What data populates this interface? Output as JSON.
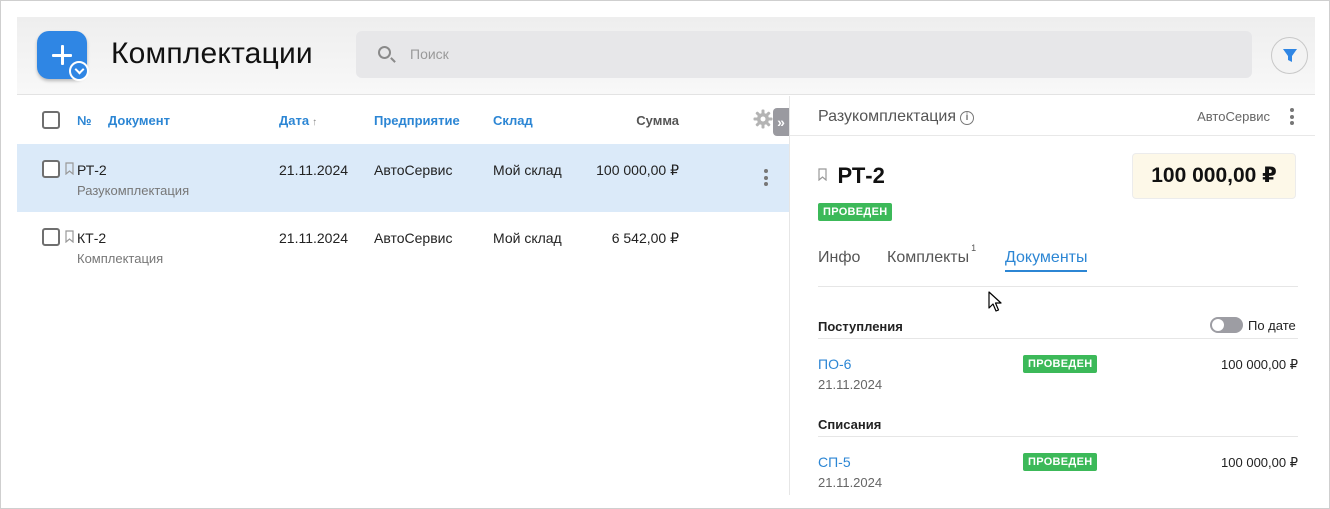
{
  "header": {
    "title": "Комплектации",
    "search_placeholder": "Поиск"
  },
  "table": {
    "columns": {
      "number": "№",
      "document": "Документ",
      "date": "Дата",
      "date_sort": "↑",
      "enterprise": "Предприятие",
      "warehouse": "Склад",
      "sum": "Сумма"
    },
    "collapse_label": "»",
    "rows": [
      {
        "number": "РТ-2",
        "type": "Разукомплектация",
        "date": "21.11.2024",
        "enterprise": "АвтоСервис",
        "warehouse": "Мой склад",
        "sum": "100 000,00 ₽",
        "selected": true
      },
      {
        "number": "КТ-2",
        "type": "Комплектация",
        "date": "21.11.2024",
        "enterprise": "АвтоСервис",
        "warehouse": "Мой склад",
        "sum": "6 542,00 ₽",
        "selected": false
      }
    ]
  },
  "detail": {
    "type": "Разукомплектация",
    "info_glyph": "i",
    "company": "АвтоСервис",
    "number": "РТ-2",
    "amount": "100 000,00 ₽",
    "status": "ПРОВЕДЕН",
    "tabs": {
      "info": "Инфо",
      "kits": "Комплекты",
      "kits_count": "1",
      "documents": "Документы"
    },
    "receipts": {
      "title": "Поступления",
      "toggle_label": "По дате",
      "doc": {
        "number": "ПО-6",
        "date": "21.11.2024",
        "status": "ПРОВЕДЕН",
        "sum": "100 000,00 ₽"
      }
    },
    "writeoffs": {
      "title": "Списания",
      "doc": {
        "number": "СП-5",
        "date": "21.11.2024",
        "status": "ПРОВЕДЕН",
        "sum": "100 000,00 ₽"
      }
    }
  },
  "colors": {
    "accent": "#2c86d4",
    "add_button": "#2f86e4",
    "selected_row": "#dbeaf9",
    "status_green": "#3cb959",
    "amount_bg": "#fdf8e8"
  },
  "icons": [
    "plus-icon",
    "chevron-down-icon",
    "search-icon",
    "filter-icon",
    "gear-icon",
    "bookmark-icon",
    "more-vertical-icon",
    "info-icon",
    "mouse-cursor-icon"
  ]
}
